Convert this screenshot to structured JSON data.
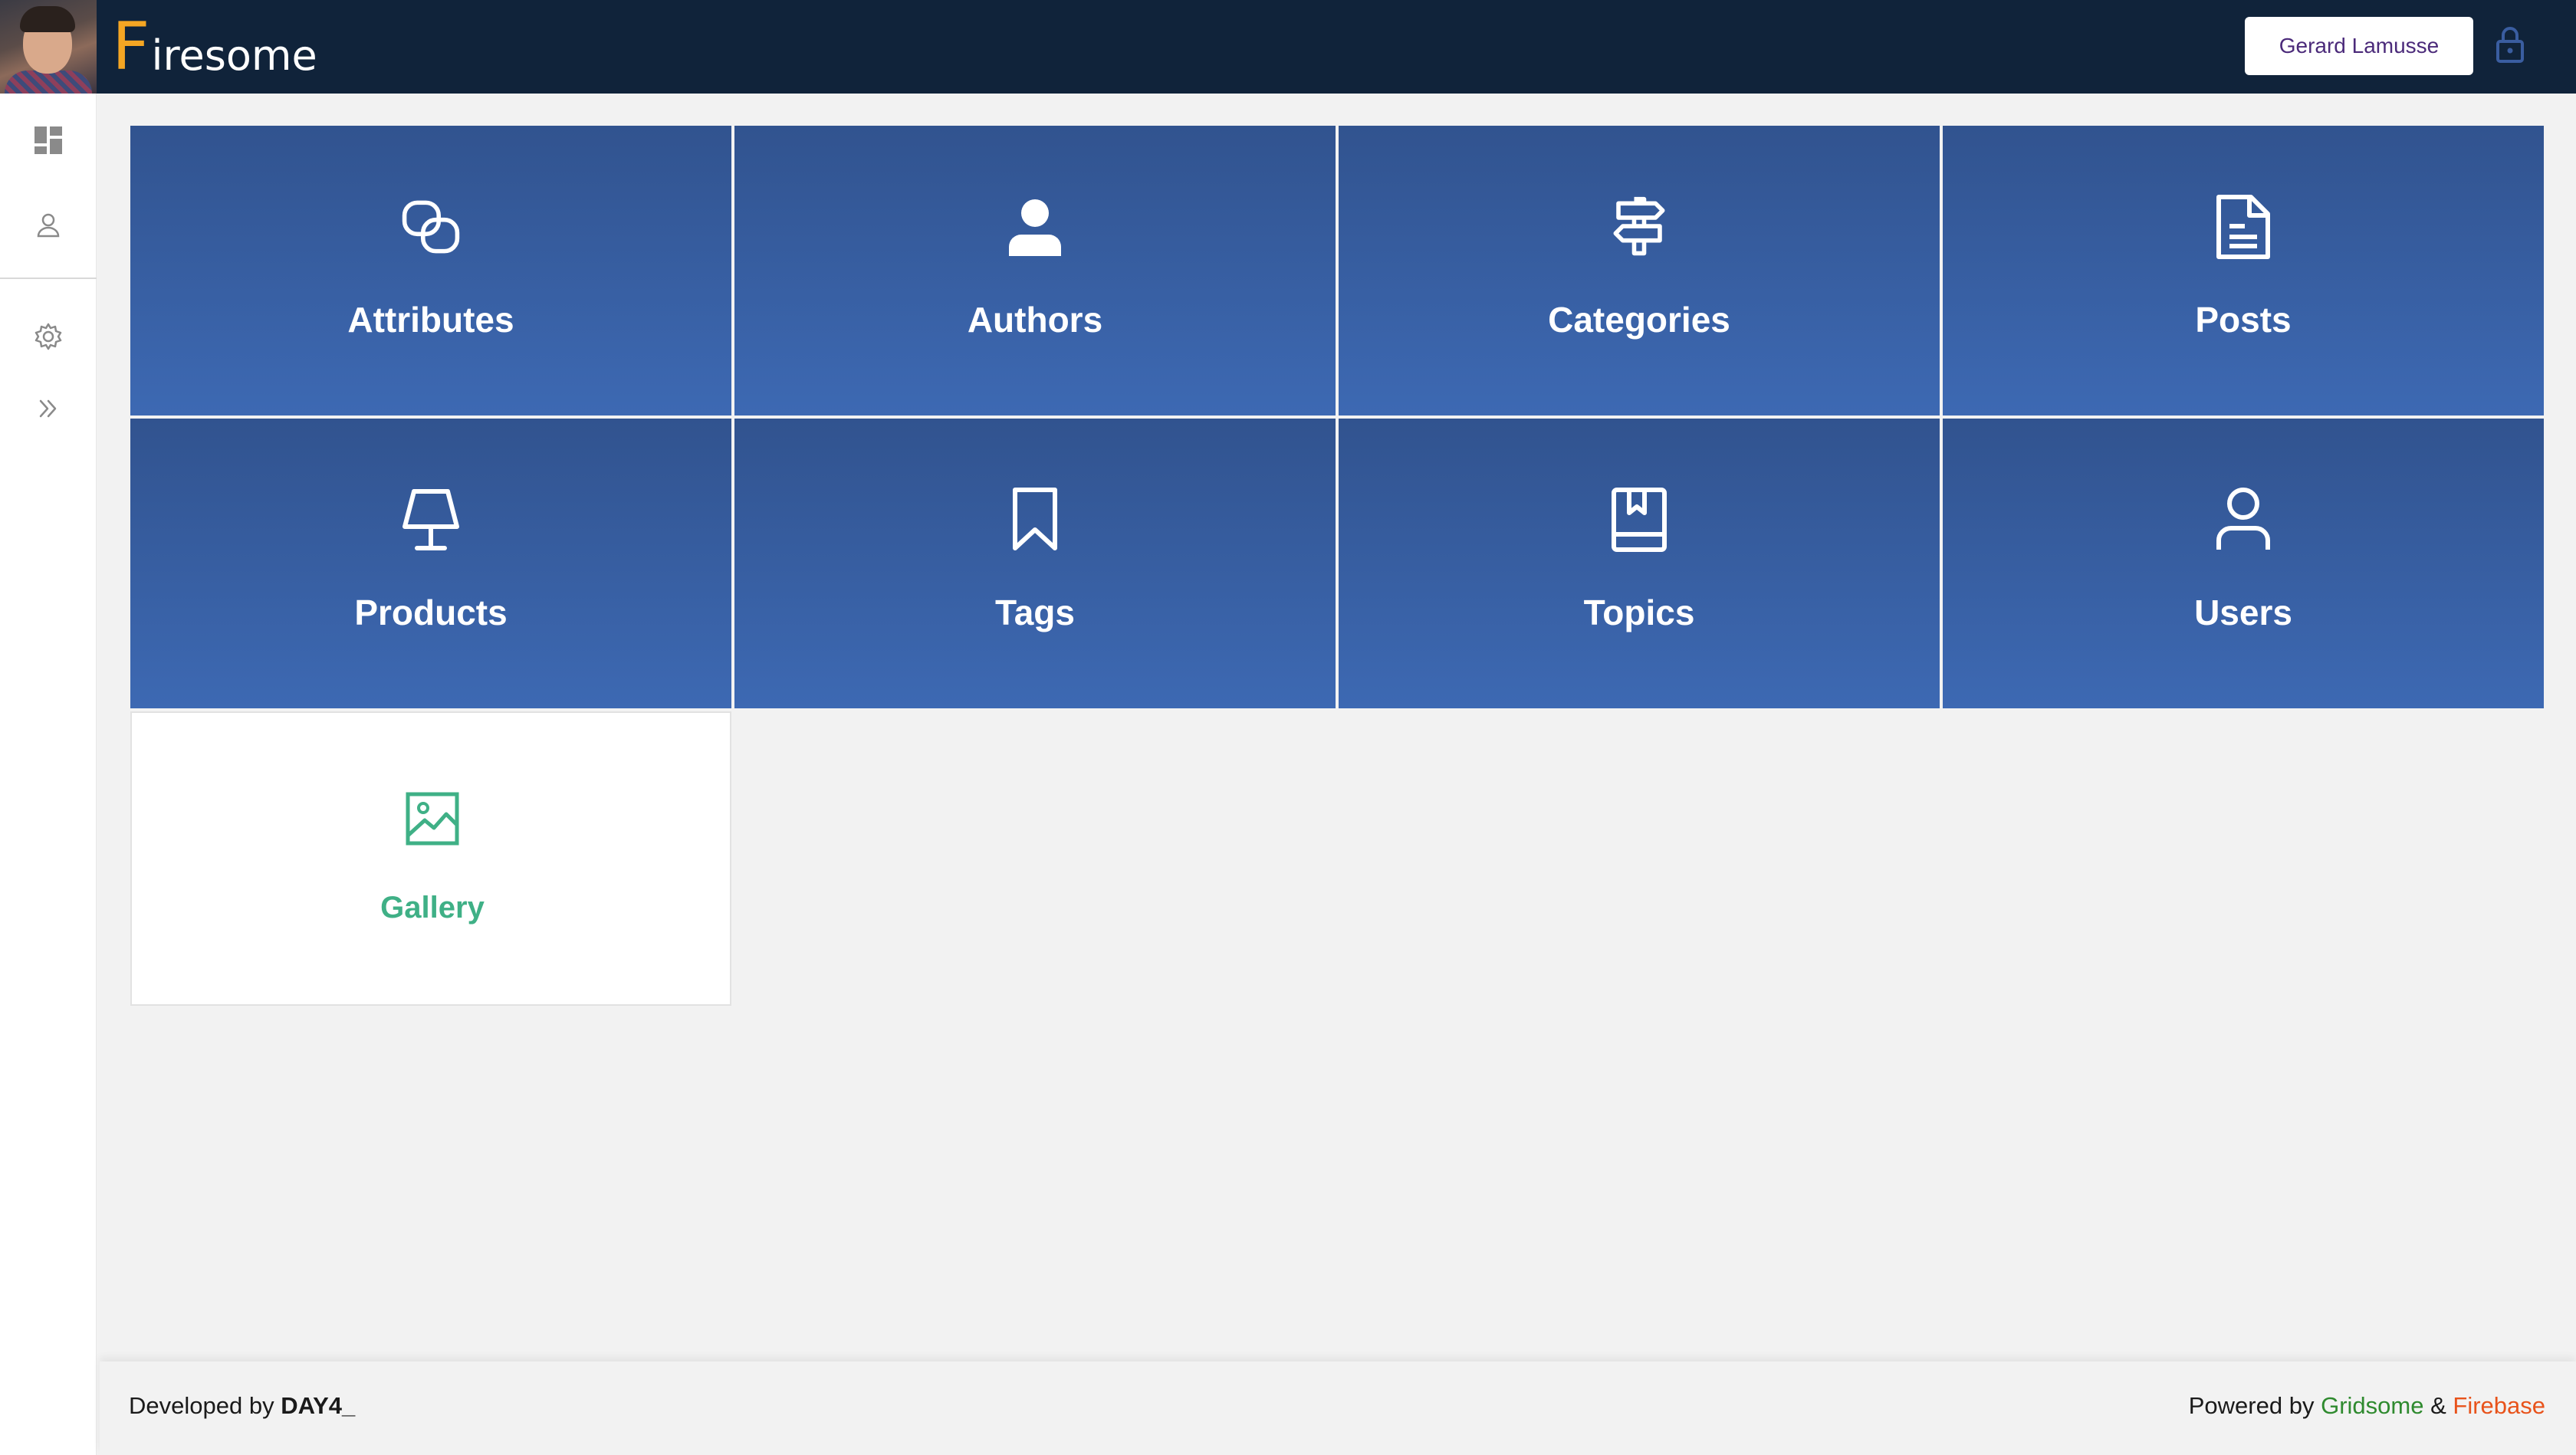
{
  "header": {
    "brand_first_letter": "F",
    "brand_rest": "iresome",
    "user_name": "Gerard Lamusse",
    "avatar_icon": "user-avatar",
    "lock_icon": "lock-icon",
    "brand_color": "#f5a623",
    "bar_color": "#10233a"
  },
  "sidebar": {
    "items": [
      {
        "icon": "dashboard-icon"
      },
      {
        "icon": "user-icon"
      },
      {
        "icon": "settings-icon"
      },
      {
        "icon": "expand-icon"
      }
    ]
  },
  "tiles": [
    {
      "label": "Attributes",
      "icon": "link-icon"
    },
    {
      "label": "Authors",
      "icon": "person-icon"
    },
    {
      "label": "Categories",
      "icon": "signpost-icon"
    },
    {
      "label": "Posts",
      "icon": "document-icon"
    },
    {
      "label": "Products",
      "icon": "lamp-icon"
    },
    {
      "label": "Tags",
      "icon": "bookmark-icon"
    },
    {
      "label": "Topics",
      "icon": "book-icon"
    },
    {
      "label": "Users",
      "icon": "user-outline-icon"
    },
    {
      "label": "Gallery",
      "icon": "image-icon"
    }
  ],
  "colors": {
    "tile_top": "#31538f",
    "tile_bottom": "#3d69b3",
    "gallery_accent": "#3fb086"
  },
  "footer": {
    "developed_prefix": "Developed by",
    "developer": "DAY4_",
    "powered_prefix": "Powered by",
    "gridsome": "Gridsome",
    "amp": "&",
    "firebase": "Firebase"
  }
}
